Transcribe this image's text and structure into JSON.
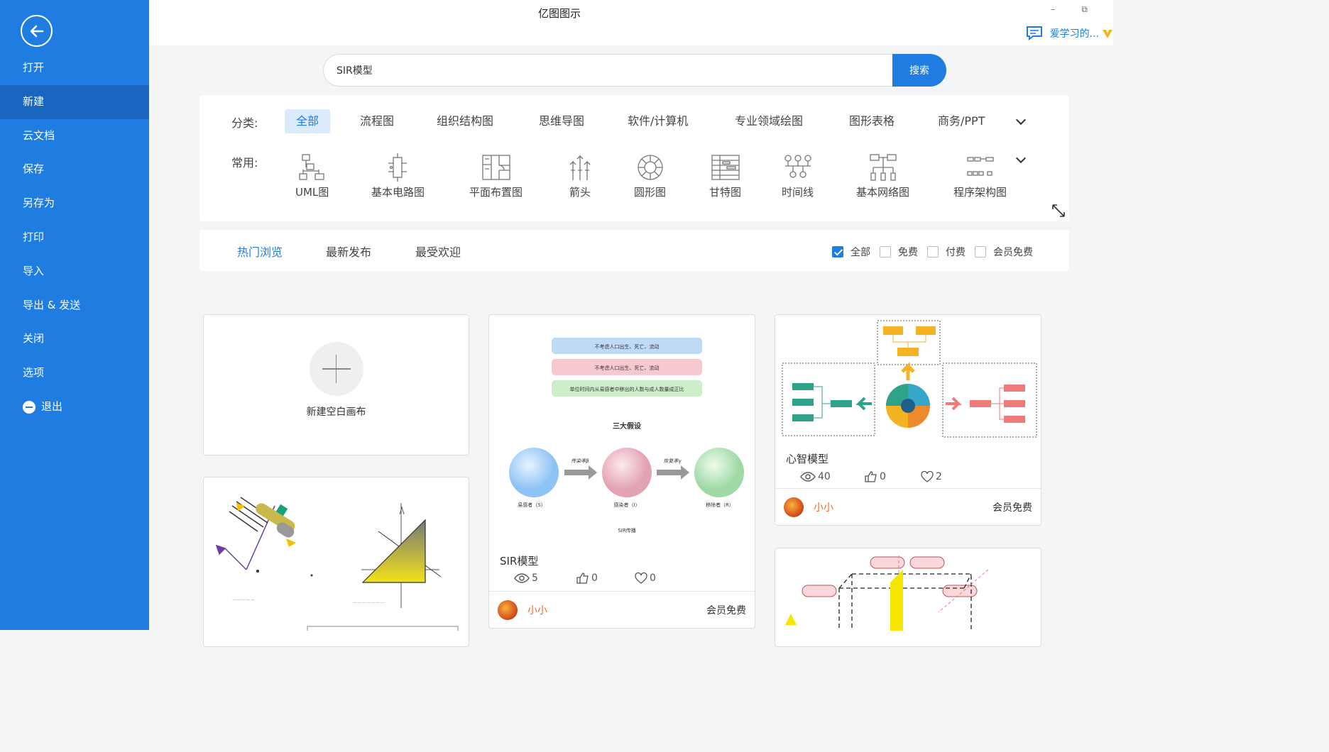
{
  "window": {
    "title": "亿图图示",
    "minimize": "–",
    "restore": "⧉",
    "user_name": "爱学习的..."
  },
  "sidebar": {
    "items": [
      {
        "label": "打开"
      },
      {
        "label": "新建"
      },
      {
        "label": "云文档"
      },
      {
        "label": "保存"
      },
      {
        "label": "另存为"
      },
      {
        "label": "打印"
      },
      {
        "label": "导入"
      },
      {
        "label": "导出 & 发送"
      },
      {
        "label": "关闭"
      },
      {
        "label": "选项"
      },
      {
        "label": "退出"
      }
    ],
    "active": "新建"
  },
  "search": {
    "value": "SIR模型",
    "button": "搜索"
  },
  "categories": {
    "label": "分类:",
    "items": [
      "全部",
      "流程图",
      "组织结构图",
      "思维导图",
      "软件/计算机",
      "专业领域绘图",
      "图形表格",
      "商务/PPT"
    ],
    "active": "全部"
  },
  "common": {
    "label": "常用:",
    "items": [
      {
        "label": "UML图",
        "icon": "uml-icon"
      },
      {
        "label": "基本电路图",
        "icon": "circuit-icon"
      },
      {
        "label": "平面布置图",
        "icon": "floorplan-icon"
      },
      {
        "label": "箭头",
        "icon": "arrow-icon"
      },
      {
        "label": "圆形图",
        "icon": "circle-diagram-icon"
      },
      {
        "label": "甘特图",
        "icon": "gantt-icon"
      },
      {
        "label": "时间线",
        "icon": "timeline-icon"
      },
      {
        "label": "基本网络图",
        "icon": "network-icon"
      },
      {
        "label": "程序架构图",
        "icon": "architecture-icon"
      }
    ]
  },
  "filter": {
    "tabs": [
      "热门浏览",
      "最新发布",
      "最受欢迎"
    ],
    "active_tab": "热门浏览",
    "checks": [
      {
        "label": "全部",
        "checked": true
      },
      {
        "label": "免费",
        "checked": false
      },
      {
        "label": "付费",
        "checked": false
      },
      {
        "label": "会员免费",
        "checked": false
      }
    ]
  },
  "new_card": {
    "label": "新建空白画布"
  },
  "templates": [
    {
      "name": "SIR模型",
      "views": "5",
      "likes": "0",
      "favs": "0",
      "author": "小小",
      "price": "会员免费",
      "preview": {
        "banners": [
          "不考虑人口出生、死亡、流动",
          "不考虑人口出生、死亡、流动",
          "单位时间内从易感者中移出的人数与成人数量成正比"
        ],
        "heading": "三大假设",
        "arrow1": "传染率β",
        "arrow2": "恢复率γ",
        "nodes": [
          "易感者（S）",
          "感染者（I）",
          "移除者（R）"
        ],
        "footer": "SIR传播"
      }
    },
    {
      "name": "心智模型",
      "views": "40",
      "likes": "0",
      "favs": "2",
      "author": "小小",
      "price": "会员免费"
    }
  ],
  "colors": {
    "primary": "#1f7ce0",
    "sidebar_active": "#1866bf",
    "author": "#f06a2a"
  }
}
